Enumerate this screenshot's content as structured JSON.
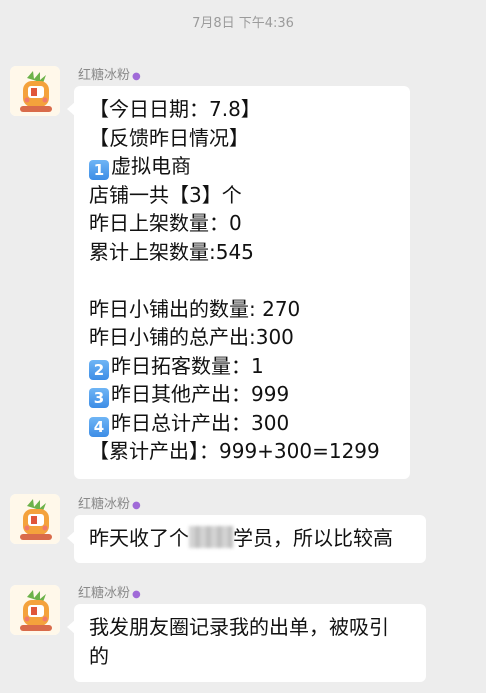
{
  "timestamp": "7月8日 下午4:36",
  "messages": [
    {
      "sender": "红糖冰粉",
      "lines": [
        {
          "text": "【今日日期：7.8】"
        },
        {
          "text": "【反馈昨日情况】"
        },
        {
          "keycap": "1",
          "text": "虚拟电商"
        },
        {
          "text": "店铺一共【3】个"
        },
        {
          "text": "昨日上架数量：0"
        },
        {
          "text": "累计上架数量:545"
        },
        {
          "text": ""
        },
        {
          "text": "昨日小铺出的数量: 270"
        },
        {
          "text": "昨日小铺的总产出:300"
        },
        {
          "keycap": "2",
          "text": "昨日拓客数量：1"
        },
        {
          "keycap": "3",
          "text": "昨日其他产出：999"
        },
        {
          "keycap": "4",
          "text": "昨日总计产出：300"
        },
        {
          "text": "【累计产出】：999+300=1299"
        }
      ]
    },
    {
      "sender": "红糖冰粉",
      "text_before": "昨天收了个",
      "text_after": "学员，所以比较高"
    },
    {
      "sender": "红糖冰粉",
      "lines": [
        {
          "text": "我发朋友圈记录我的出单，被吸引"
        },
        {
          "text": "的"
        }
      ]
    }
  ]
}
